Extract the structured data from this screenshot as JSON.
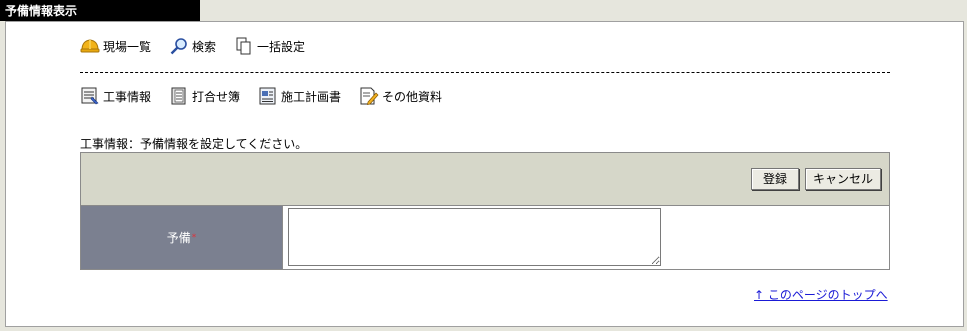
{
  "window": {
    "title": "予備情報表示"
  },
  "top_nav": [
    {
      "label": "現場一覧",
      "icon": "hardhat-icon"
    },
    {
      "label": "検索",
      "icon": "magnifier-icon"
    },
    {
      "label": "一括設定",
      "icon": "copy-pages-icon"
    }
  ],
  "sub_nav": [
    {
      "label": "工事情報",
      "icon": "list-form-icon"
    },
    {
      "label": "打合せ簿",
      "icon": "notebook-icon"
    },
    {
      "label": "施工計画書",
      "icon": "plan-doc-icon"
    },
    {
      "label": "その他資料",
      "icon": "edit-doc-icon"
    }
  ],
  "message": "工事情報：予備情報を設定してください。",
  "form": {
    "register_label": "登録",
    "cancel_label": "キャンセル",
    "field_label": "予備",
    "required_mark": "*",
    "field_value": ""
  },
  "footer": {
    "top_link": "↑ このページのトップへ"
  },
  "colors": {
    "title_bg": "#000000",
    "button_bar": "#d6d7c9",
    "label_cell": "#7b8090",
    "required": "#e0303a",
    "link": "#1a1ad6"
  }
}
